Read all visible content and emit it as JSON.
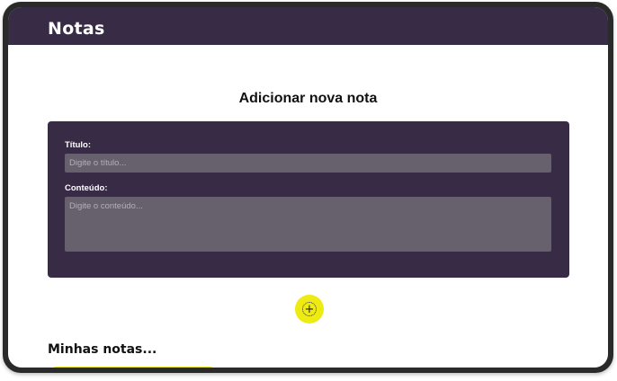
{
  "app": {
    "title": "Notas"
  },
  "form": {
    "heading": "Adicionar nova nota",
    "title_label": "Título:",
    "title_placeholder": "Digite o título...",
    "title_value": "",
    "content_label": "Conteúdo:",
    "content_placeholder": "Digite o conteúdo...",
    "content_value": ""
  },
  "add_button": {
    "icon": "plus-circle-icon"
  },
  "notes_section": {
    "heading": "Minhas notas..."
  },
  "colors": {
    "primary": "#372b45",
    "accent": "#eeea13",
    "input_bg": "#67606d",
    "background": "#ffffff"
  }
}
